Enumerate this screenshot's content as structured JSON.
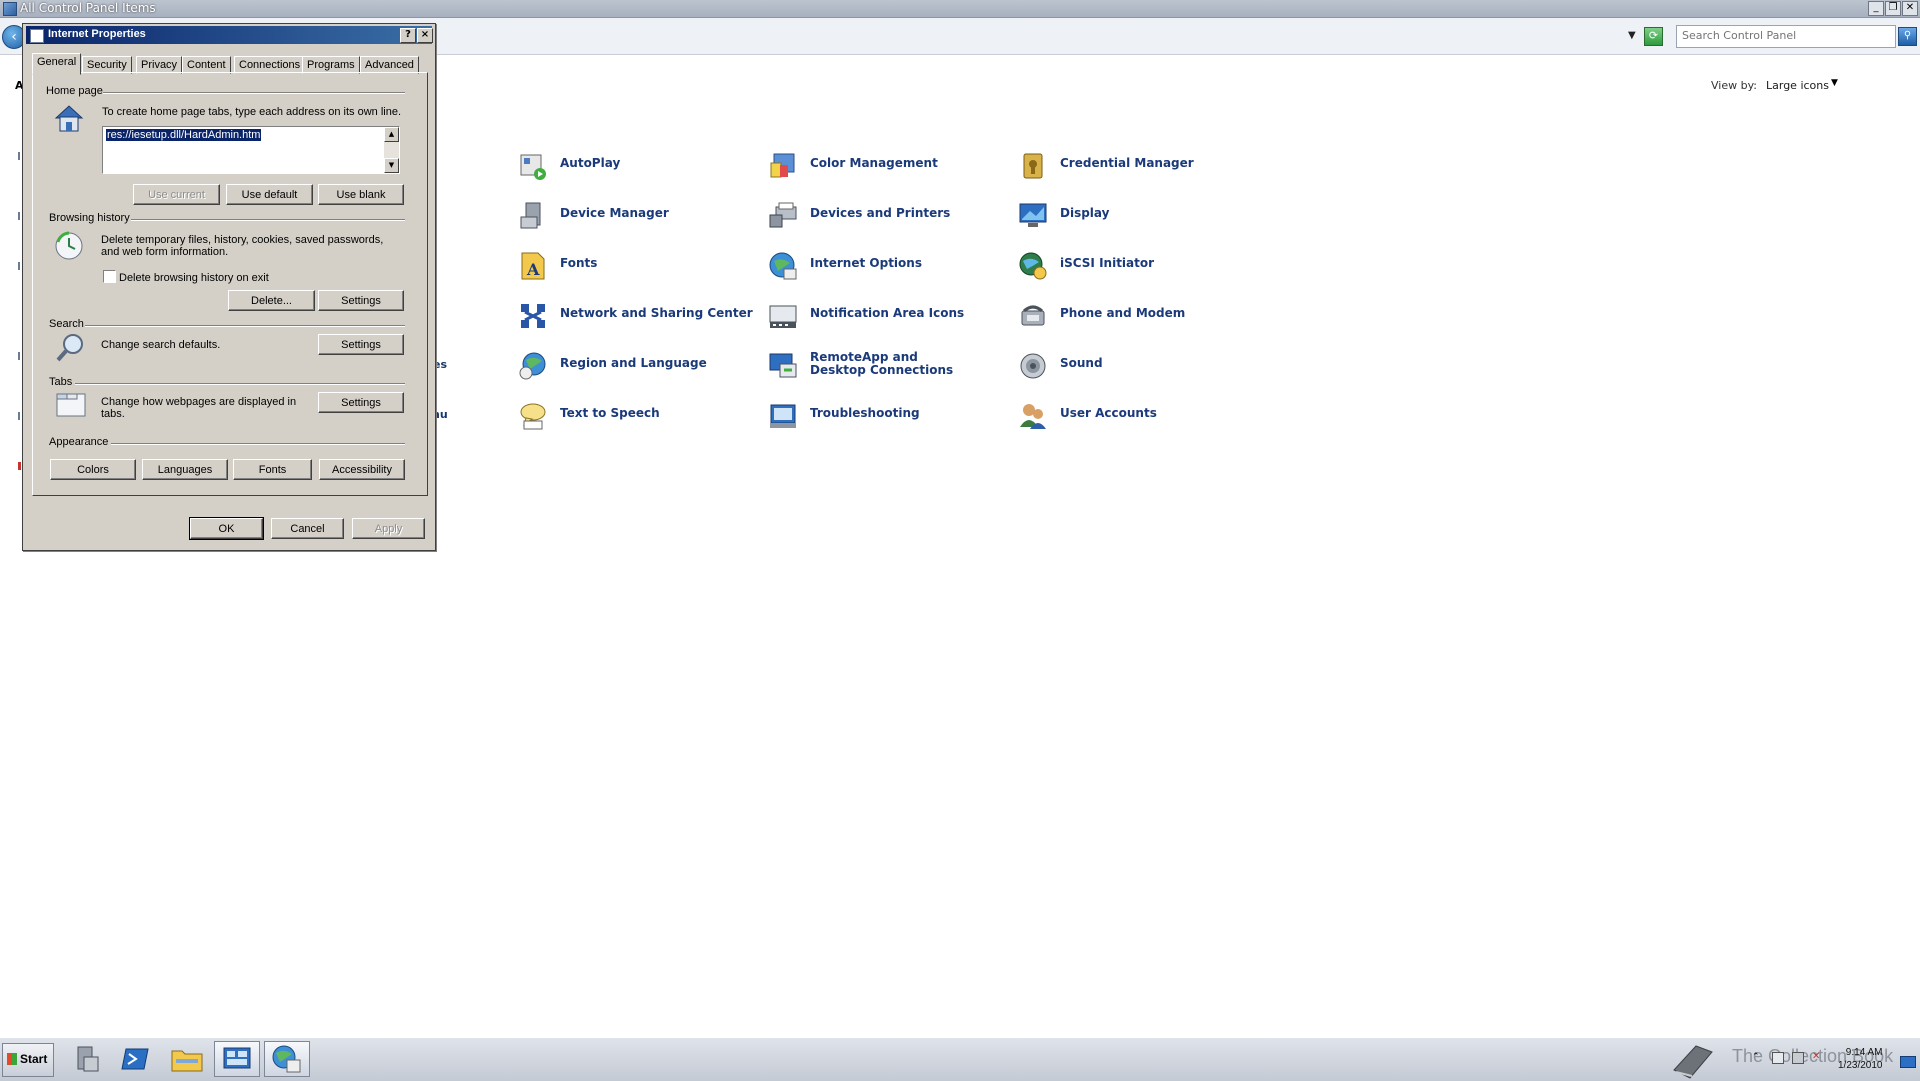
{
  "control_panel": {
    "window_title": "All Control Panel Items",
    "search_placeholder": "Search Control Panel",
    "view_by_label": "View by:",
    "view_by_value": "Large icons",
    "partial_labels": [
      "A",
      "es",
      "nu"
    ],
    "items": [
      {
        "label": "AutoPlay",
        "icon": "autoplay-icon"
      },
      {
        "label": "Color Management",
        "icon": "color-management-icon"
      },
      {
        "label": "Credential Manager",
        "icon": "credential-manager-icon"
      },
      {
        "label": "Device Manager",
        "icon": "device-manager-icon"
      },
      {
        "label": "Devices and Printers",
        "icon": "devices-printers-icon"
      },
      {
        "label": "Display",
        "icon": "display-icon"
      },
      {
        "label": "Fonts",
        "icon": "fonts-icon"
      },
      {
        "label": "Internet Options",
        "icon": "internet-options-icon"
      },
      {
        "label": "iSCSI Initiator",
        "icon": "iscsi-icon"
      },
      {
        "label": "Network and Sharing Center",
        "icon": "network-icon"
      },
      {
        "label": "Notification Area Icons",
        "icon": "notification-icon"
      },
      {
        "label": "Phone and Modem",
        "icon": "phone-icon"
      },
      {
        "label": "Region and Language",
        "icon": "region-icon"
      },
      {
        "label": "RemoteApp and Desktop Connections",
        "icon": "remoteapp-icon"
      },
      {
        "label": "Sound",
        "icon": "sound-icon"
      },
      {
        "label": "Text to Speech",
        "icon": "speech-icon"
      },
      {
        "label": "Troubleshooting",
        "icon": "troubleshooting-icon"
      },
      {
        "label": "User Accounts",
        "icon": "user-accounts-icon"
      }
    ]
  },
  "dialog": {
    "title": "Internet Properties",
    "help_label": "?",
    "close_label": "×",
    "tabs": [
      "General",
      "Security",
      "Privacy",
      "Content",
      "Connections",
      "Programs",
      "Advanced"
    ],
    "home_page": {
      "group_label": "Home page",
      "instructions": "To create home page tabs, type each address on its own line.",
      "address": "res://iesetup.dll/HardAdmin.htm",
      "use_current": "Use current",
      "use_default": "Use default",
      "use_blank": "Use blank"
    },
    "browsing_history": {
      "group_label": "Browsing history",
      "description_line1": "Delete temporary files, history, cookies, saved passwords,",
      "description_line2": "and web form information.",
      "checkbox_label": "Delete browsing history on exit",
      "checkbox_checked": false,
      "delete_label": "Delete...",
      "settings_label": "Settings"
    },
    "search": {
      "group_label": "Search",
      "description": "Change search defaults.",
      "settings_label": "Settings"
    },
    "tabs_group": {
      "group_label": "Tabs",
      "description_line1": "Change how webpages are displayed in",
      "description_line2": "tabs.",
      "settings_label": "Settings"
    },
    "appearance": {
      "group_label": "Appearance",
      "colors": "Colors",
      "languages": "Languages",
      "fonts": "Fonts",
      "accessibility": "Accessibility"
    },
    "ok_label": "OK",
    "cancel_label": "Cancel",
    "apply_label": "Apply"
  },
  "taskbar": {
    "start_label": "Start",
    "watermark": "The Collection Book",
    "clock_time": "9:14 AM",
    "clock_date": "1/23/2010"
  }
}
